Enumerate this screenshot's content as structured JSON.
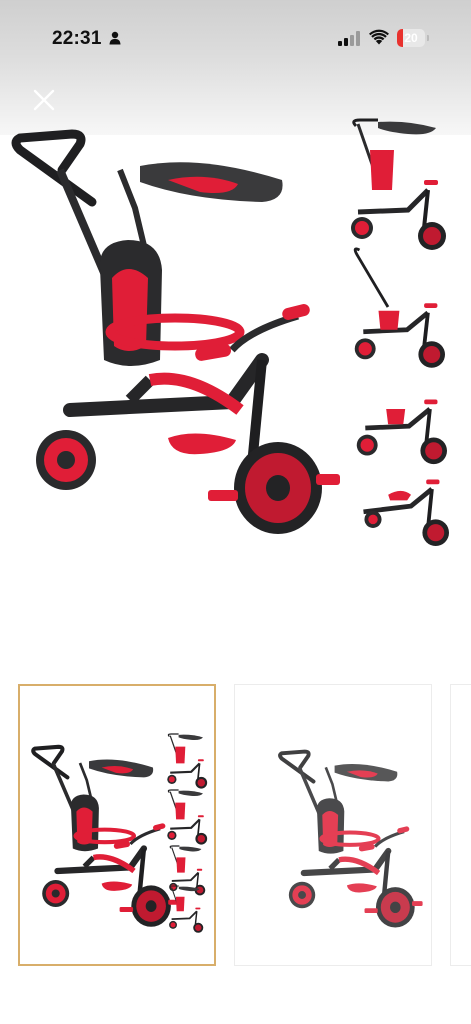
{
  "status_bar": {
    "time": "22:31",
    "battery_level": "20",
    "battery_fraction": 0.2,
    "signal_bars_active": 2,
    "signal_bars_total": 4,
    "icons": [
      "person-icon",
      "signal-icon",
      "wifi-icon",
      "battery-icon"
    ]
  },
  "viewer": {
    "close_icon": "close-icon",
    "selected_index": 0,
    "thumbnail_count": 3
  },
  "colors": {
    "accent_red": "#e01e37",
    "frame_dark": "#2b2b2d",
    "selected_border": "#d8ae6a",
    "battery_red": "#e8322e"
  }
}
